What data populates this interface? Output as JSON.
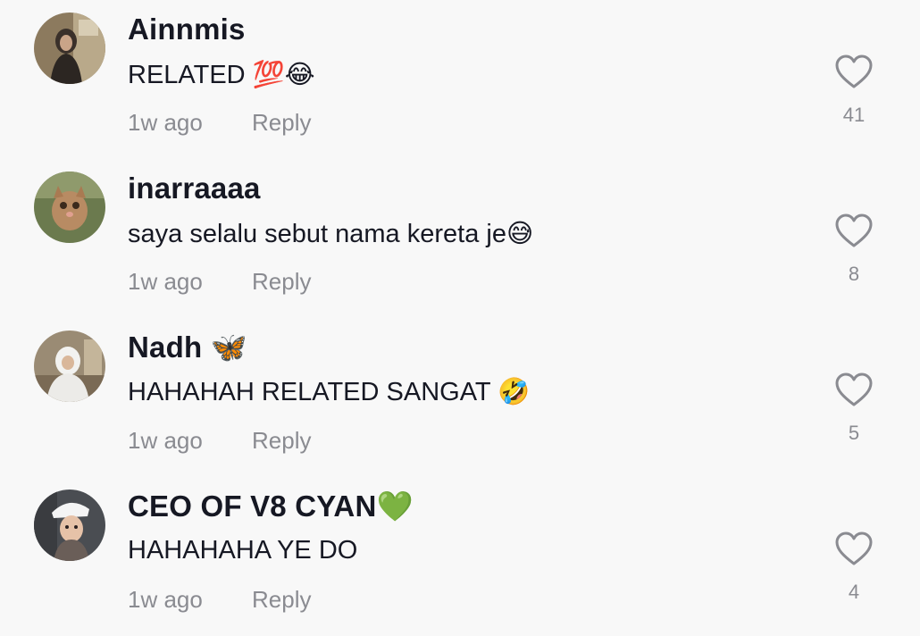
{
  "comments": [
    {
      "username": "Ainnmis",
      "text": "RELATED 💯😂",
      "time": "1w ago",
      "reply": "Reply",
      "likes": "41"
    },
    {
      "username": "inarraaaa",
      "text": "saya selalu sebut nama kereta je😅",
      "time": "1w ago",
      "reply": "Reply",
      "likes": "8"
    },
    {
      "username": "Nadh 🦋",
      "text": "HAHAHAH RELATED SANGAT 🤣",
      "time": "1w ago",
      "reply": "Reply",
      "likes": "5"
    },
    {
      "username": "CEO OF V8 CYAN💚",
      "text": "HAHAHAHA YE DO",
      "time": "1w ago",
      "reply": "Reply",
      "likes": "4"
    }
  ],
  "colors": {
    "background": "#f8f8f8",
    "primary_text": "#161823",
    "secondary_text": "#8a8b91"
  },
  "icons": {
    "like": "heart-outline-icon"
  }
}
